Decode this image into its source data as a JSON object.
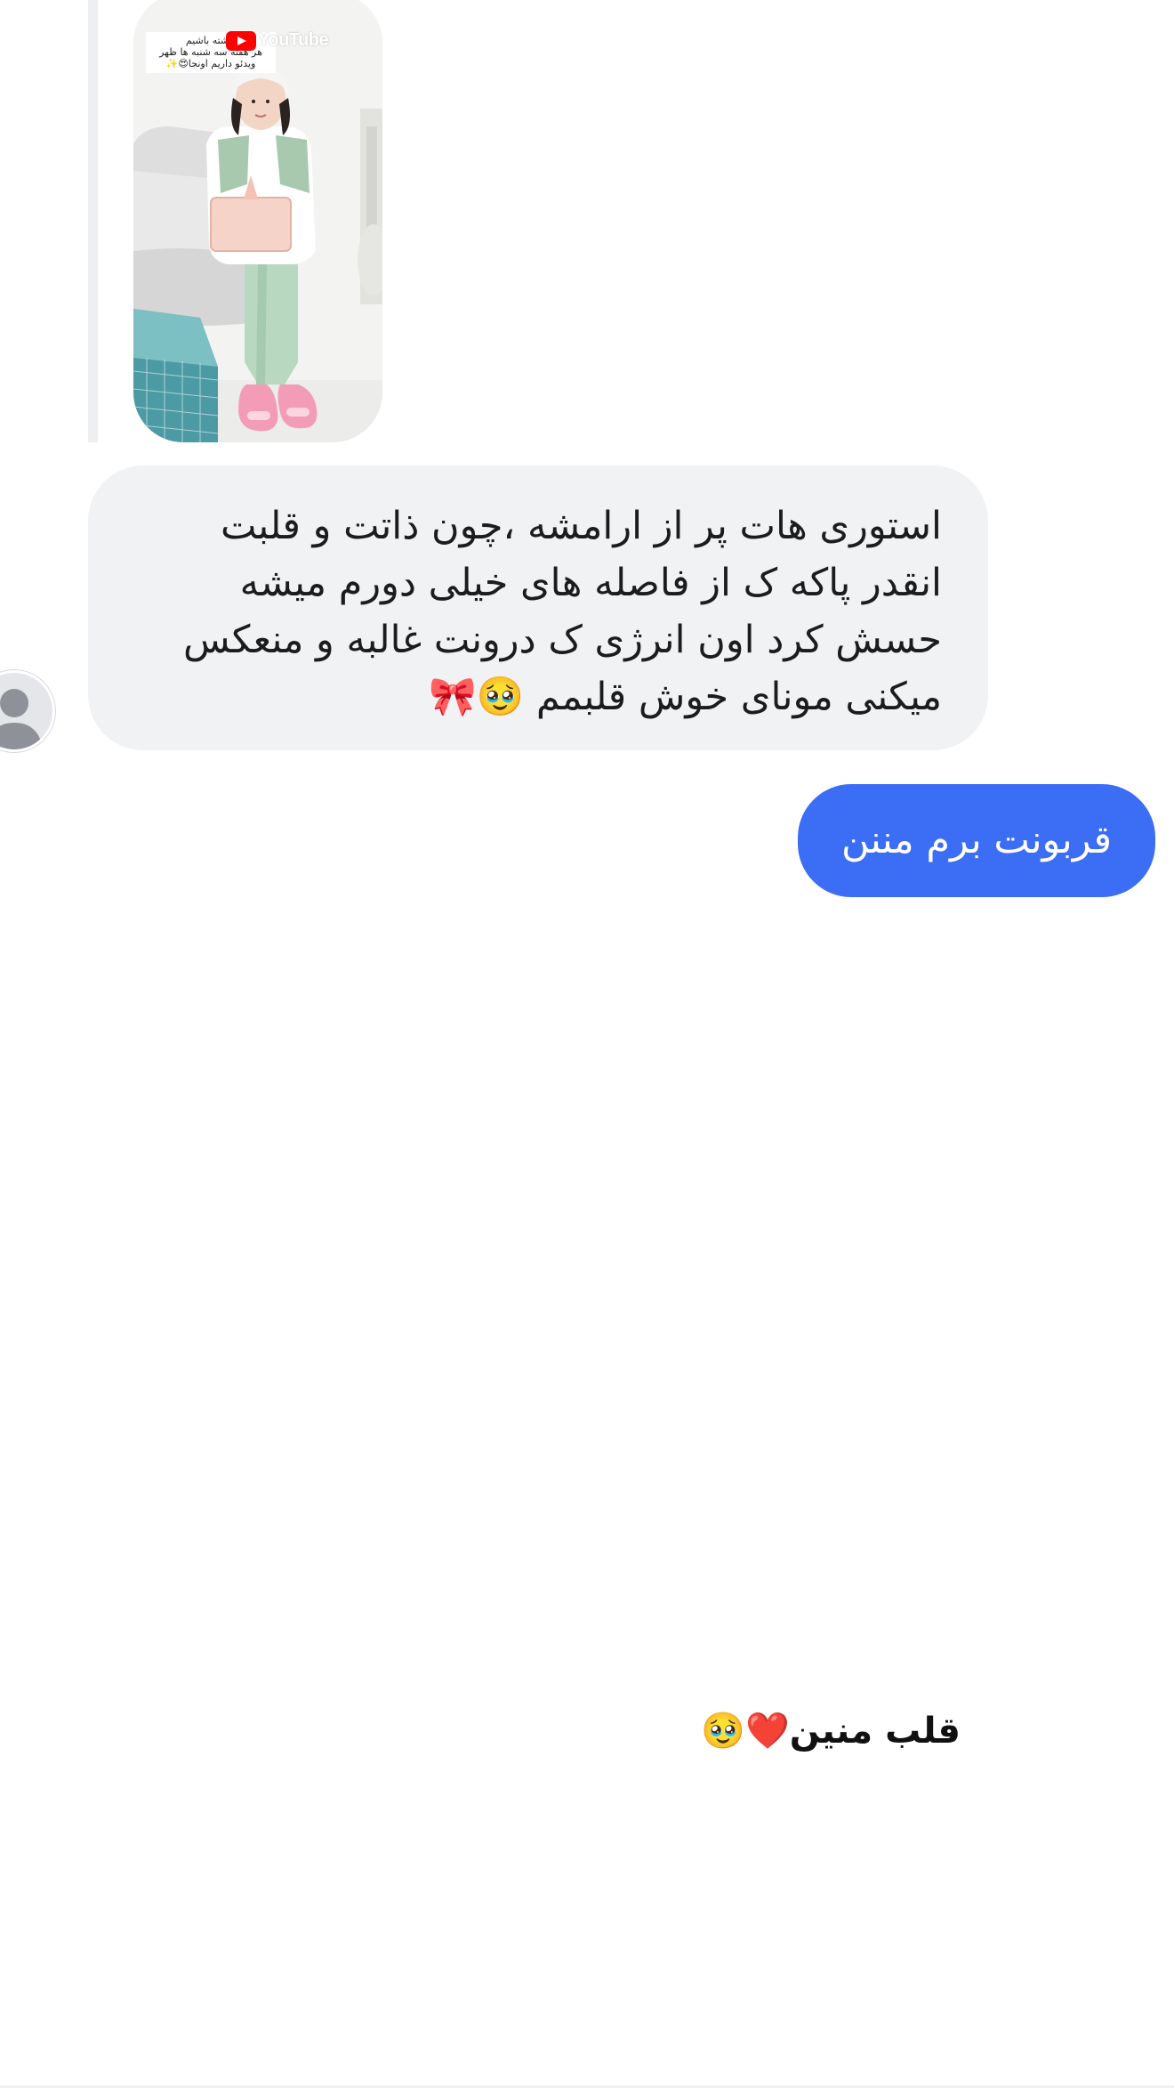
{
  "story_reply": {
    "overlay_lines": [
      "داشته باشیم",
      "هر هفته سه شنبه ها ظهر",
      "ویدئو داریم اونجا😍✨"
    ],
    "badge_text": "YouTube"
  },
  "messages": [
    {
      "direction": "incoming",
      "lines": [
        "استوری هات پر از ارامشه ،چون ذاتت و قلبت",
        "انقدر پاکه ک از فاصله های خیلی دورم میشه",
        "حسش کرد اون انرژی ک درونت غالبه و منعکس",
        "میکنی مونای خوش قلبمم 🥹🎀"
      ]
    },
    {
      "direction": "outgoing",
      "text": "قربونت برم مننن"
    }
  ],
  "caption": "قلب منین❤️🥹",
  "colors": {
    "outgoing_bubble": "#3b6df5",
    "incoming_bubble": "#f1f2f4",
    "reply_bar": "#eeeff1",
    "avatar_bg": "#e4e6ea",
    "avatar_glyph": "#8e9197"
  },
  "icons": {
    "avatar": "person-silhouette-icon",
    "story_badge": "youtube-play-icon"
  }
}
